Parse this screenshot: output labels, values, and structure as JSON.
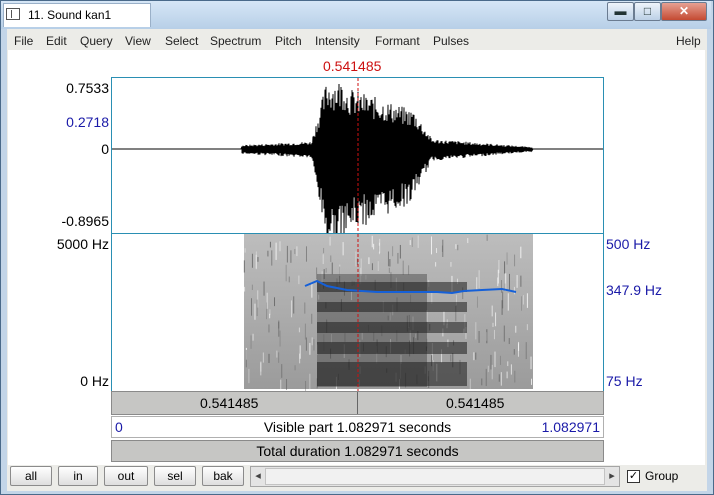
{
  "window": {
    "title": "11. Sound kan1",
    "minimize_glyph": "▬",
    "maximize_glyph": "□",
    "close_glyph": "✕"
  },
  "menu": [
    "File",
    "Edit",
    "Query",
    "View",
    "Select",
    "Spectrum",
    "Pitch",
    "Intensity",
    "Formant",
    "Pulses",
    "Help"
  ],
  "cursor_time": "0.541485",
  "waveform": {
    "y_top": "0.7533",
    "y_cursor": "0.2718",
    "y_zero": "0",
    "y_bottom": "-0.8965"
  },
  "spectrogram": {
    "freq_top": "5000 Hz",
    "freq_bottom": "0 Hz",
    "pitch_top": "500 Hz",
    "pitch_cursor": "347.9 Hz",
    "pitch_bottom": "75 Hz"
  },
  "time_bar": {
    "left_value": "0.541485",
    "right_value": "0.541485"
  },
  "visible_bar": {
    "start": "0",
    "label": "Visible part 1.082971 seconds",
    "end": "1.082971"
  },
  "total_bar": {
    "label": "Total duration 1.082971 seconds"
  },
  "controls": {
    "buttons": [
      "all",
      "in",
      "out",
      "sel",
      "bak"
    ],
    "scroll_left": "◂",
    "scroll_right": "▸",
    "group_label": "Group",
    "group_checked": true,
    "check_mark": "✓"
  },
  "colors": {
    "cursor": "#cc1111",
    "pitch_line": "#1560d8",
    "axis_blue": "#1a1aa8",
    "pane_border": "#2a8fb3"
  }
}
